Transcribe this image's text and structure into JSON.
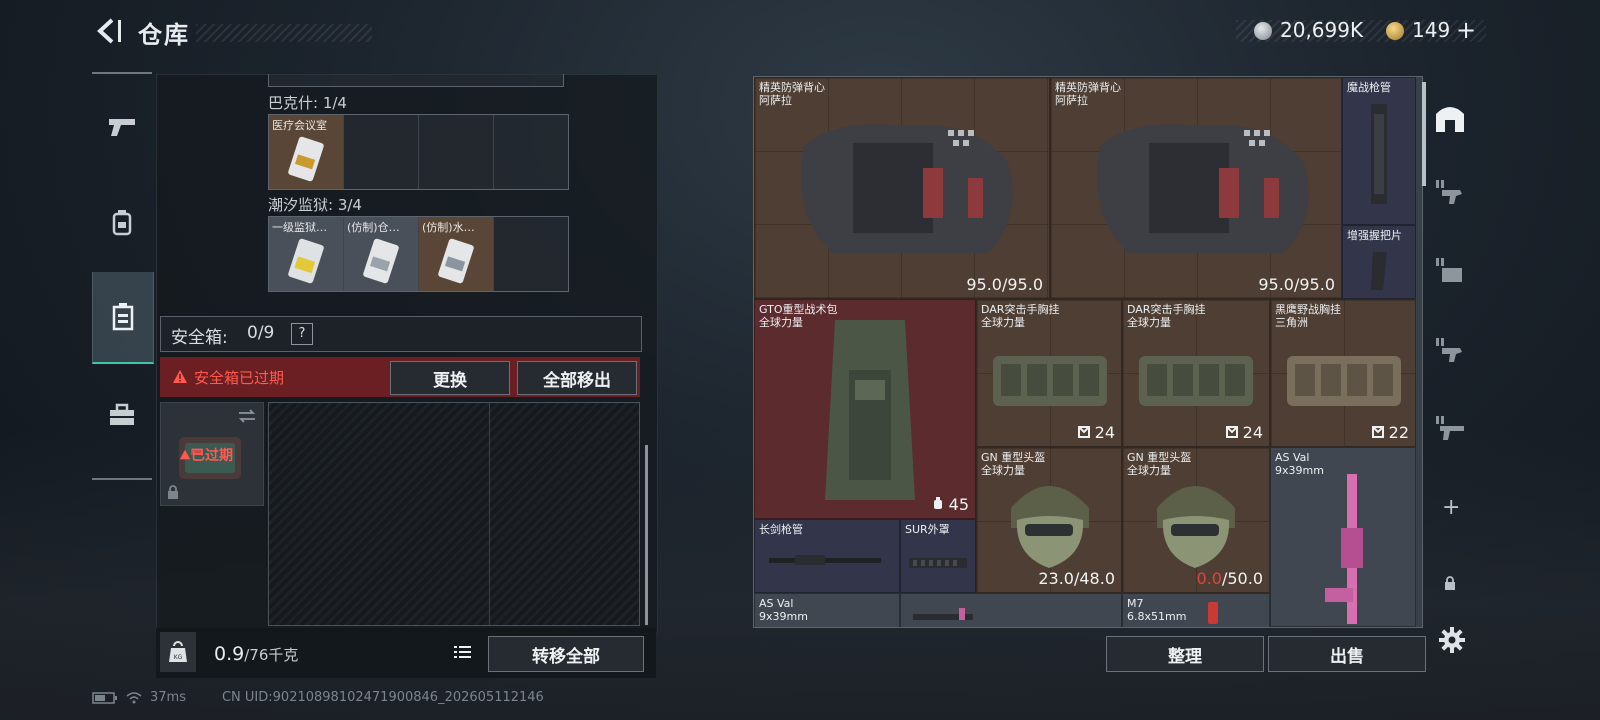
{
  "header": {
    "title": "仓库",
    "currency1": "20,699K",
    "currency2": "149",
    "currency2_add": "+"
  },
  "nav": {
    "items": [
      "firearm-icon",
      "backpack-icon",
      "container-icon",
      "toolbox-icon"
    ],
    "active_index": 2
  },
  "left": {
    "section_partial_top": "",
    "bakshi": {
      "label": "巴克什: 1/4",
      "items": [
        {
          "label": "医疗会议室",
          "color": "brown"
        }
      ]
    },
    "prison": {
      "label": "潮汐监狱: 3/4",
      "items": [
        {
          "label": "一级监狱…",
          "color": "gray"
        },
        {
          "label": "(仿制)仓…",
          "color": "gray"
        },
        {
          "label": "(仿制)水…",
          "color": "brown"
        }
      ]
    },
    "safebox": {
      "label": "安全箱:",
      "count": "0/9",
      "help": "?"
    },
    "expire": {
      "message": "安全箱已过期",
      "replace_btn": "更换",
      "remove_all_btn": "全部移出",
      "badge": "已过期"
    },
    "weight": {
      "current": "0.9",
      "max": "/76千克"
    },
    "transfer_btn": "转移全部"
  },
  "right": {
    "tiles": [
      {
        "name": "精英防弹背心\n阿萨拉",
        "value": "95.0/95.0",
        "color": "brown"
      },
      {
        "name": "精英防弹背心\n阿萨拉",
        "value": "95.0/95.0",
        "color": "brown"
      },
      {
        "name": "魔战枪管",
        "value": "",
        "color": "blue"
      },
      {
        "name": "增强握把片",
        "value": "",
        "color": "blue"
      },
      {
        "name": "GTO重型战术包\n全球力量",
        "value": "45",
        "color": "red"
      },
      {
        "name": "DAR突击手胸挂\n全球力量",
        "value": "24",
        "color": "brown"
      },
      {
        "name": "DAR突击手胸挂\n全球力量",
        "value": "24",
        "color": "brown"
      },
      {
        "name": "黑鹰野战胸挂\n三角洲",
        "value": "22",
        "color": "brown"
      },
      {
        "name": "GN 重型头盔\n全球力量",
        "value": "23.0/48.0",
        "color": "brown"
      },
      {
        "name": "GN 重型头盔\n全球力量",
        "value_red": "0.0",
        "value_rest": "/50.0",
        "color": "brown"
      },
      {
        "name": "AS Val\n9x39mm",
        "value": "",
        "color": "slate"
      },
      {
        "name": "长剑枪管",
        "value": "",
        "color": "blue"
      },
      {
        "name": "SUR外罩",
        "value": "",
        "color": "blue"
      },
      {
        "name": "AS Val\n9x39mm",
        "value": "",
        "color": "slate"
      },
      {
        "name": "",
        "value": "",
        "color": "slate"
      },
      {
        "name": "M7\n6.8x51mm",
        "value": "",
        "color": "slate"
      }
    ],
    "sort_btn": "整理",
    "sell_btn": "出售"
  },
  "sidebar_right": {
    "add": "+"
  },
  "status": {
    "ping": "37ms",
    "uid": "CN UID:902108981024719008​46_202605112146"
  }
}
